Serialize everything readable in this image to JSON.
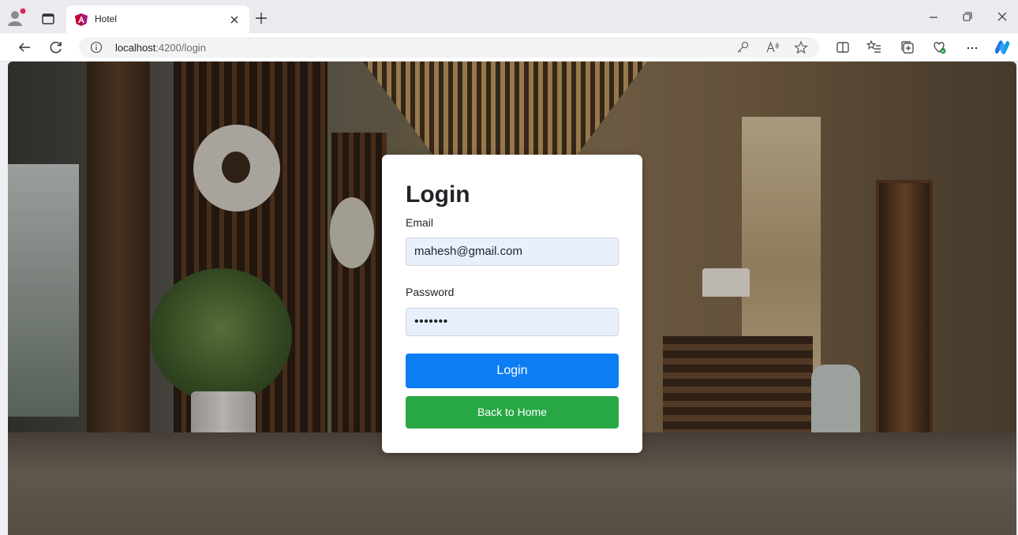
{
  "browser": {
    "tab": {
      "title": "Hotel"
    },
    "address": {
      "host": "localhost",
      "path": ":4200/login"
    }
  },
  "icons": {
    "profile": "profile-icon",
    "tab_actions": "tab-actions-icon",
    "favicon": "angular-favicon-icon",
    "tab_close": "close-icon",
    "new_tab": "plus-icon",
    "minimize": "minimize-icon",
    "restore": "restore-icon",
    "close_window": "close-icon",
    "back": "back-arrow-icon",
    "refresh": "refresh-icon",
    "site_info": "info-icon",
    "password_key": "key-icon",
    "read_aloud": "read-aloud-icon",
    "favorite": "star-icon",
    "split_screen": "split-screen-icon",
    "favorites_list": "favorites-list-icon",
    "collections": "collections-icon",
    "performance": "performance-icon",
    "more": "more-icon",
    "copilot": "copilot-icon"
  },
  "login": {
    "title": "Login",
    "email_label": "Email",
    "email_value": "mahesh@gmail.com",
    "password_label": "Password",
    "password_value": "•••••••",
    "login_button": "Login",
    "home_button": "Back to Home"
  },
  "colors": {
    "primary": "#0d7df4",
    "success": "#28a745",
    "input_bg": "#e8f0fe"
  }
}
